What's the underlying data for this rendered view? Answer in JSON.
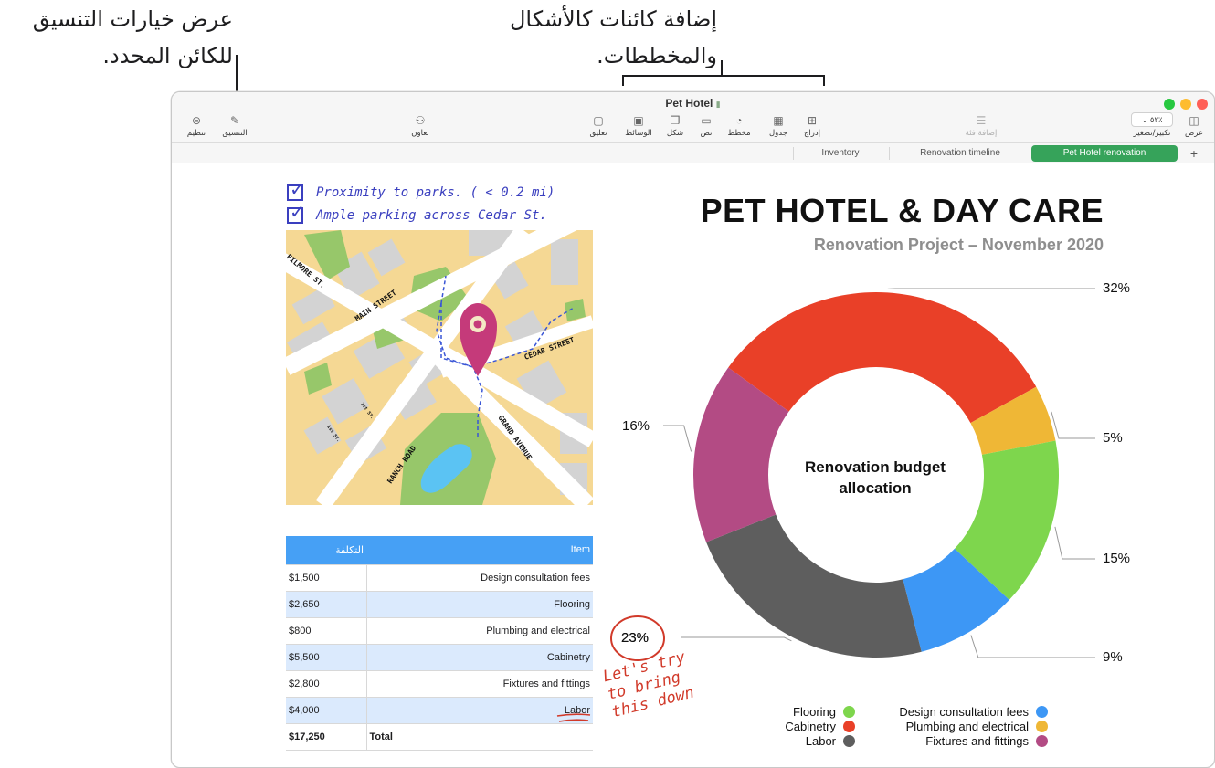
{
  "callouts": {
    "format": {
      "line1": "عرض خيارات التنسيق",
      "line2": "للكائن المحدد."
    },
    "insert": {
      "line1": "إضافة كائنات كالأشكال",
      "line2": "والمخططات."
    }
  },
  "window": {
    "title": "Pet Hotel",
    "traffic_colors": [
      "#27c840",
      "#febc2e",
      "#ff5f57"
    ]
  },
  "toolbar": {
    "view": "عرض",
    "zoom": "تكبير/تصغير",
    "zoom_value": "٥٢٪",
    "add_category": "إضافة فئة",
    "insert": "إدراج",
    "table": "جدول",
    "chart": "مخطط",
    "text": "نص",
    "shape": "شكل",
    "media": "الوسائط",
    "comment": "تعليق",
    "collaborate": "تعاون",
    "format": "التنسيق",
    "organize": "تنظيم"
  },
  "tabs": {
    "items": [
      "Pet Hotel renovation",
      "Renovation timeline",
      "Inventory"
    ],
    "active": "Pet Hotel renovation",
    "add": "+"
  },
  "checklist": [
    "Proximity to parks. ( < 0.2 mi)",
    "Ample parking across Cedar St."
  ],
  "map": {
    "labels": [
      "FILMORE ST.",
      "MAIN STREET",
      "CEDAR STREET",
      "GRAND AVENUE",
      "RANCH ROAD",
      "1st ST.",
      "1st ST."
    ]
  },
  "table": {
    "headers": {
      "cost": "التكلفة",
      "item": "Item"
    },
    "rows": [
      {
        "cost": "$1,500",
        "item": "Design consultation fees"
      },
      {
        "cost": "$2,650",
        "item": "Flooring"
      },
      {
        "cost": "$800",
        "item": "Plumbing and electrical"
      },
      {
        "cost": "$5,500",
        "item": "Cabinetry"
      },
      {
        "cost": "$2,800",
        "item": "Fixtures and fittings"
      },
      {
        "cost": "$4,000",
        "item": "Labor"
      }
    ],
    "total": {
      "cost": "$17,250",
      "item": "Total"
    }
  },
  "annotation": {
    "circled": "23%",
    "note_lines": [
      "Let's try",
      "to bring",
      "this down"
    ]
  },
  "chart_data": {
    "type": "pie",
    "title": "PET HOTEL & DAY CARE",
    "subtitle": "Renovation Project – November 2020",
    "center_label": "Renovation budget allocation",
    "slices": [
      {
        "label": "Cabinetry",
        "value": 32,
        "color": "#e94028"
      },
      {
        "label": "Fixtures and fittings",
        "value": 5,
        "color": "#efb736"
      },
      {
        "label": "Flooring",
        "value": 15,
        "color": "#7ed64d"
      },
      {
        "label": "Design consultation fees",
        "value": 9,
        "color": "#3d97f5"
      },
      {
        "label": "Labor",
        "value": 23,
        "color": "#5e5e5e"
      },
      {
        "label": "Plumbing and electrical",
        "value": 16,
        "color": "#b34b84"
      }
    ],
    "percent_labels": [
      "32%",
      "5%",
      "15%",
      "9%",
      "23%",
      "16%"
    ],
    "legend": [
      {
        "label": "Flooring",
        "color": "#7ed64d"
      },
      {
        "label": "Cabinetry",
        "color": "#e94028"
      },
      {
        "label": "Labor",
        "color": "#5e5e5e"
      },
      {
        "label": "Design consultation fees",
        "color": "#3d97f5"
      },
      {
        "label": "Plumbing and electrical",
        "color": "#efb736"
      },
      {
        "label": "Fixtures and fittings",
        "color": "#b34b84"
      }
    ]
  }
}
